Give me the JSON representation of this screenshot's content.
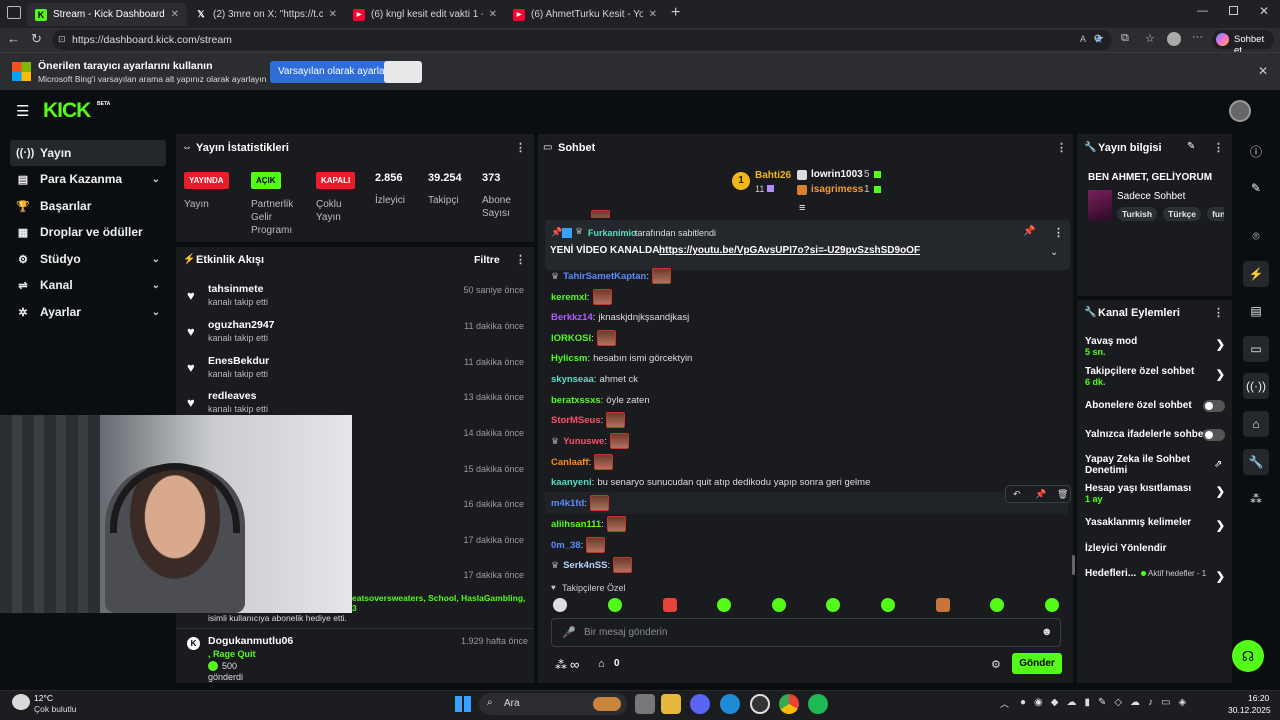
{
  "browser": {
    "tabs": [
      {
        "label": "Stream - Kick Dashboard",
        "icon": "kick-icon",
        "active": true
      },
      {
        "label": "(2) 3mre on X: \"https://t.co/63FSs",
        "icon": "x-logo-icon"
      },
      {
        "label": "(6) kngl kesit edit vakti 1 - YouTub",
        "icon": "youtube-icon"
      },
      {
        "label": "(6) AhmetTurku Kesit - YouTube",
        "icon": "youtube-icon"
      }
    ],
    "url": "https://dashboard.kick.com/stream",
    "profile_label": "Sohbet et"
  },
  "infobar": {
    "title": "Önerilen tarayıcı ayarlarını kullanın",
    "subtitle": "Microsoft Bing'i varsayılan arama alt yapınız olarak ayarlayın",
    "primary_button": "Varsayılan olarak ayarla",
    "secondary_button": "Kapat"
  },
  "kick": {
    "logo": "KICK",
    "beta": "BETA"
  },
  "sidebar": {
    "items": [
      {
        "label": "Yayın",
        "icon": "broadcast-icon",
        "active": true
      },
      {
        "label": "Para Kazanma",
        "icon": "money-icon",
        "chevron": true
      },
      {
        "label": "Başarılar",
        "icon": "trophy-icon"
      },
      {
        "label": "Droplar ve ödüller",
        "icon": "gift-icon"
      },
      {
        "label": "Stüdyo",
        "icon": "studio-icon",
        "chevron": true
      },
      {
        "label": "Kanal",
        "icon": "channel-icon",
        "chevron": true
      },
      {
        "label": "Ayarlar",
        "icon": "gear-icon",
        "chevron": true
      }
    ]
  },
  "stats": {
    "title": "Yayın İstatistikleri",
    "live_badge": "YAYINDA",
    "live_label": "Yayın",
    "partner_badge": "AÇIK",
    "partner_label": "Partnerlik Gelir Programı",
    "multi_badge": "KAPALI",
    "multi_label": "Çoklu Yayın",
    "viewers": "2.856",
    "viewers_label": "İzleyici",
    "followers": "39.254",
    "followers_label": "Takipçi",
    "subs": "373",
    "subs_label": "Abone Sayısı"
  },
  "activity": {
    "title": "Etkinlik Akışı",
    "filter": "Filtre",
    "items": [
      {
        "name": "tahsinmete",
        "text": "kanalı takip etti",
        "time": "50 saniye önce"
      },
      {
        "name": "oguzhan2947",
        "text": "kanalı takip etti",
        "time": "11 dakika önce"
      },
      {
        "name": "EnesBekdur",
        "text": "kanalı takip etti",
        "time": "11 dakika önce"
      },
      {
        "name": "redleaves",
        "text": "kanalı takip etti",
        "time": "13 dakika önce"
      },
      {
        "time": "14 dakika önce"
      },
      {
        "time": "15 dakika önce"
      },
      {
        "time": "16 dakika önce"
      },
      {
        "time": "17 dakika önce"
      },
      {
        "time": "17 dakika önce"
      }
    ],
    "gift_names": "eatsoversweaters, School, HaslaGambling,",
    "gift_num": "3",
    "gift_text": "isimli kullanıcıya abonelik hediye etti.",
    "last_name": "Dogukanmutlu06",
    "last_time": "1.929 hafta önce",
    "last_reward": ", Rage Quit",
    "last_amount": "500",
    "last_sub": "gönderdi"
  },
  "chat": {
    "title": "Sohbet",
    "top": [
      {
        "rank": "1",
        "name": "Bahti26",
        "count": "11"
      },
      {
        "name": "lowrin1003",
        "count": "5"
      },
      {
        "name": "isagrimess",
        "count": "1"
      }
    ],
    "pinned_by_user": "Furkanimio",
    "pinned_by_text": "tarafından sabitlendi",
    "pinned_prefix": "YENİ VİDEO KANALDA :",
    "pinned_link": "https://youtu.be/VpGAvsUPI7o?si=-U29pvSzshSD9oOF",
    "lines": [
      {
        "user": "TahirSametKaptan",
        "color": "#5b8cff",
        "emote": true,
        "badge": true
      },
      {
        "user": "keremxl",
        "color": "#53fc18",
        "emote": true
      },
      {
        "user": "Berkkz14",
        "color": "#b05cff",
        "msg": "jknaskjdnjkşsandjkasj"
      },
      {
        "user": "lORKOSl",
        "color": "#53fc18",
        "emote": true
      },
      {
        "user": "Hylicsm",
        "color": "#53fc18",
        "msg": "hesabın ismi görcektyin"
      },
      {
        "user": "skynseaa",
        "color": "#53e0c2",
        "msg": "ahmet ck"
      },
      {
        "user": "beratxssxs",
        "color": "#53fc18",
        "msg": "öyle zaten"
      },
      {
        "user": "StorMSeus",
        "color": "#ff4d6d",
        "emote": true
      },
      {
        "user": "Yunuswe",
        "color": "#ff4d6d",
        "emote": true,
        "badge": true
      },
      {
        "user": "Canlaaff",
        "color": "#ff8c1a",
        "emote": true
      },
      {
        "user": "kaanyeni",
        "color": "#53e0c2",
        "msg": "bu senaryo sunucudan quit atıp dedikodu yapıp sonra geri gelme"
      },
      {
        "user": "m4k1fd",
        "color": "#5b8cff",
        "emote": true
      },
      {
        "user": "aliihsan111",
        "color": "#53fc18",
        "emote": true
      },
      {
        "user": "0m_38",
        "color": "#5b8cff",
        "emote": true
      },
      {
        "user": "Serk4nSS",
        "color": "#b8d4ff",
        "emote": true,
        "badge": true
      }
    ],
    "followers_only": "Takipçilere Özel",
    "input_placeholder": "Bir mesaj gönderin",
    "points": "∞",
    "store_count": "0",
    "send": "Gönder"
  },
  "info": {
    "title": "Yayın bilgisi",
    "stream_title": "BEN AHMET, GELİYORUM",
    "category": "Sadece Sohbet",
    "tags": [
      "Turkish",
      "Türkçe",
      "fun"
    ]
  },
  "actions": {
    "title": "Kanal Eylemleri",
    "slow_mode": "Yavaş mod",
    "slow_value": "5 sn.",
    "followers_chat": "Takipçilere özel sohbet",
    "followers_value": "6 dk.",
    "subs_chat": "Abonelere özel sohbet",
    "emote_chat": "Yalnızca ifadelerle sohbet",
    "ai_mod": "Yapay Zeka ile Sohbet Denetimi",
    "age": "Hesap yaşı kısıtlaması",
    "age_value": "1 ay",
    "banned_words": "Yasaklanmış kelimeler",
    "redirect": "İzleyici Yönlendir",
    "goals": "Hedefleri...",
    "goals_active": "Aktif hedefler - 1"
  },
  "taskbar": {
    "temp": "12°C",
    "weather": "Çok bulutlu",
    "search": "Ara",
    "time": "16:20",
    "date": "30.12.2025"
  }
}
